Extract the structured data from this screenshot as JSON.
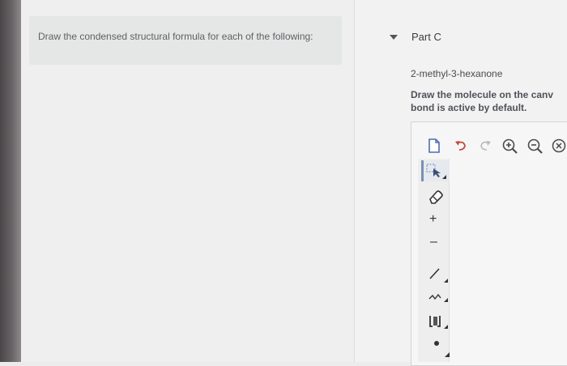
{
  "instructions": {
    "text": "Draw the condensed structural formula for each of the following:"
  },
  "part": {
    "label": "Part C",
    "compound": "2-methyl-3-hexanone",
    "draw_instruction_line1": "Draw the molecule on the canv",
    "draw_instruction_line2": "bond is active by default."
  },
  "toolbar": {
    "top_tools": [
      "new-document-icon",
      "undo-icon",
      "redo-icon",
      "zoom-in-icon",
      "zoom-out-icon",
      "clear-icon"
    ],
    "side_tools": [
      "select-icon",
      "eraser-icon",
      "add-charge-icon",
      "remove-charge-icon",
      "single-bond-icon",
      "chain-icon",
      "template-icon",
      "dot-icon"
    ],
    "plus_glyph": "+",
    "minus_glyph": "–"
  },
  "colors": {
    "panel": "#efefef",
    "instructions_bg": "#e4e7e6",
    "text": "#5f5f64",
    "accent": "#7b8fb5"
  }
}
